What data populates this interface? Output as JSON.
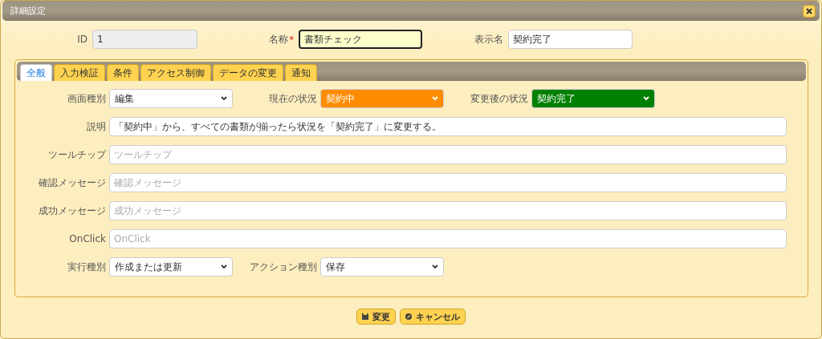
{
  "dialog": {
    "title": "詳細設定"
  },
  "header_fields": [
    {
      "label": "ID",
      "value": "1",
      "disabled": true,
      "focused": false
    },
    {
      "label": "名称",
      "required_mark": "*",
      "value": "書類チェック",
      "disabled": false,
      "focused": true
    },
    {
      "label": "表示名",
      "value": "契約完了",
      "disabled": false,
      "focused": false
    }
  ],
  "tabs": [
    {
      "label": "全般",
      "selected": true
    },
    {
      "label": "入力検証",
      "selected": false
    },
    {
      "label": "条件",
      "selected": false
    },
    {
      "label": "アクセス制御",
      "selected": false
    },
    {
      "label": "データの変更",
      "selected": false
    },
    {
      "label": "通知",
      "selected": false
    }
  ],
  "form_rows": [
    [
      {
        "kind": "select",
        "label": "画面種別",
        "value": "編集"
      },
      {
        "kind": "select",
        "label": "現在の状況",
        "value": "契約中",
        "color": "#ff8c00"
      },
      {
        "kind": "select",
        "label": "変更後の状況",
        "value": "契約完了",
        "color": "#008000"
      }
    ],
    [
      {
        "kind": "text",
        "label": "説明",
        "value": "「契約中」から、すべての書類が揃ったら状況を「契約完了」に変更する。"
      }
    ],
    [
      {
        "kind": "text",
        "label": "ツールチップ",
        "placeholder": "ツールチップ"
      }
    ],
    [
      {
        "kind": "text",
        "label": "確認メッセージ",
        "placeholder": "確認メッセージ"
      }
    ],
    [
      {
        "kind": "text",
        "label": "成功メッセージ",
        "placeholder": "成功メッセージ"
      }
    ],
    [
      {
        "kind": "text",
        "label": "OnClick",
        "placeholder": "OnClick"
      }
    ],
    [
      {
        "kind": "select",
        "label": "実行種別",
        "value": "作成または更新"
      },
      {
        "kind": "select",
        "label": "アクション種別",
        "value": "保存"
      }
    ]
  ],
  "buttons": [
    {
      "kind": "save",
      "label": "変更"
    },
    {
      "kind": "cancel",
      "label": "キャンセル"
    }
  ]
}
